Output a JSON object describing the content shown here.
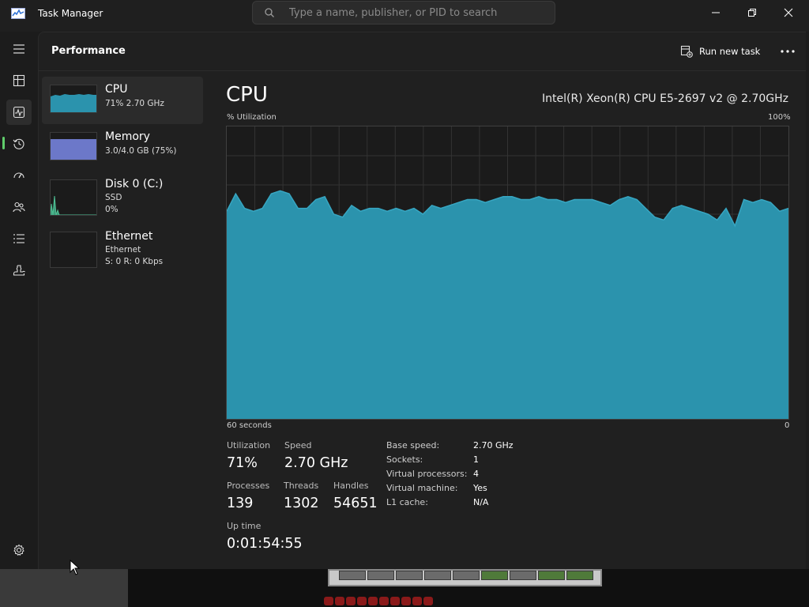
{
  "window": {
    "title": "Task Manager",
    "search_placeholder": "Type a name, publisher, or PID to search"
  },
  "header": {
    "page_title": "Performance",
    "run_task_label": "Run new task"
  },
  "nav": {
    "items": [
      {
        "name": "hamburger-menu",
        "icon": "hamburger-icon"
      },
      {
        "name": "processes",
        "icon": "processes-icon"
      },
      {
        "name": "performance",
        "icon": "performance-icon",
        "active": true
      },
      {
        "name": "app-history",
        "icon": "history-icon"
      },
      {
        "name": "startup-apps",
        "icon": "startup-icon"
      },
      {
        "name": "users",
        "icon": "users-icon"
      },
      {
        "name": "details",
        "icon": "details-list-icon"
      },
      {
        "name": "services",
        "icon": "services-icon"
      }
    ],
    "settings_icon": "gear-icon"
  },
  "resources": [
    {
      "name": "CPU",
      "line1": "71% 2.70 GHz",
      "selected": true
    },
    {
      "name": "Memory",
      "line1": "3.0/4.0 GB (75%)"
    },
    {
      "name": "Disk 0 (C:)",
      "line1": "SSD",
      "line2": "0%"
    },
    {
      "name": "Ethernet",
      "line1": "Ethernet",
      "line2": "S: 0 R: 0 Kbps"
    }
  ],
  "detail": {
    "title": "CPU",
    "model": "Intel(R) Xeon(R) CPU E5-2697 v2 @ 2.70GHz",
    "y_label": "% Utilization",
    "y_max": "100%",
    "x_label": "60 seconds",
    "x_min": "0"
  },
  "stats": {
    "utilization_label": "Utilization",
    "utilization_value": "71%",
    "speed_label": "Speed",
    "speed_value": "2.70 GHz",
    "processes_label": "Processes",
    "processes_value": "139",
    "threads_label": "Threads",
    "threads_value": "1302",
    "handles_label": "Handles",
    "handles_value": "54651",
    "uptime_label": "Up time",
    "uptime_value": "0:01:54:55"
  },
  "info": [
    {
      "key": "Base speed:",
      "value": "2.70 GHz"
    },
    {
      "key": "Sockets:",
      "value": "1"
    },
    {
      "key": "Virtual processors:",
      "value": "4"
    },
    {
      "key": "Virtual machine:",
      "value": "Yes"
    },
    {
      "key": "L1 cache:",
      "value": "N/A"
    }
  ],
  "colors": {
    "cpu_graph": "#2b93ad",
    "cpu_graph_line": "#37a6c2",
    "memory_graph": "#6c78c9",
    "disk_graph": "#3f9b7a",
    "accent": "#60cd6b"
  },
  "chart_data": {
    "type": "area",
    "ylim": [
      0,
      100
    ],
    "values": [
      71,
      77,
      72,
      71,
      72,
      77,
      78,
      77,
      72,
      72,
      75,
      76,
      70,
      69,
      73,
      71,
      72,
      72,
      71,
      72,
      71,
      72,
      70,
      73,
      72,
      73,
      74,
      75,
      75,
      74,
      75,
      76,
      76,
      75,
      75,
      76,
      75,
      75,
      74,
      75,
      75,
      75,
      74,
      73,
      75,
      76,
      75,
      72,
      69,
      68,
      72,
      73,
      72,
      71,
      70,
      68,
      72,
      66,
      75,
      74,
      75,
      74,
      71,
      72
    ]
  }
}
